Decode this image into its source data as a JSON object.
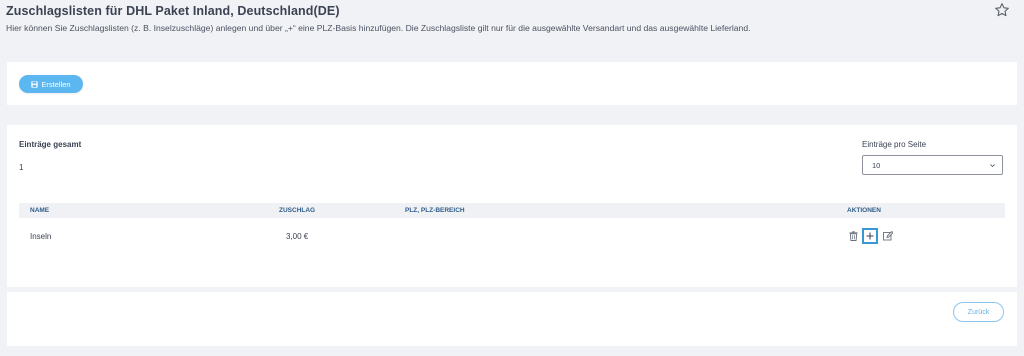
{
  "header": {
    "title": "Zuschlagslisten für DHL Paket Inland, Deutschland(DE)",
    "description": "Hier können Sie Zuschlagslisten (z. B. Inselzuschläge) anlegen und über „+“ eine PLZ-Basis hinzufügen. Die Zuschlagsliste gilt nur für die ausgewählte Versandart und das ausgewählte Lieferland.",
    "favorite_icon": "star-outline-icon"
  },
  "toolbar": {
    "create_label": "Erstellen",
    "create_icon": "save-icon"
  },
  "summary": {
    "total_label": "Einträge gesamt",
    "total_value": "1",
    "per_page_label": "Einträge pro Seite",
    "per_page_value": "10"
  },
  "table": {
    "columns": [
      "NAME",
      "ZUSCHLAG",
      "PLZ, PLZ-BEREICH",
      "AKTIONEN"
    ],
    "rows": [
      {
        "name": "Inseln",
        "surcharge": "3,00 €",
        "zip": ""
      }
    ],
    "action_icons": [
      "trash-icon",
      "plus-icon",
      "edit-icon"
    ]
  },
  "footer": {
    "back_label": "Zurück"
  },
  "colors": {
    "accent": "#5cb6ef",
    "header_text": "#2f5d8a",
    "background": "#f1f2f5"
  }
}
